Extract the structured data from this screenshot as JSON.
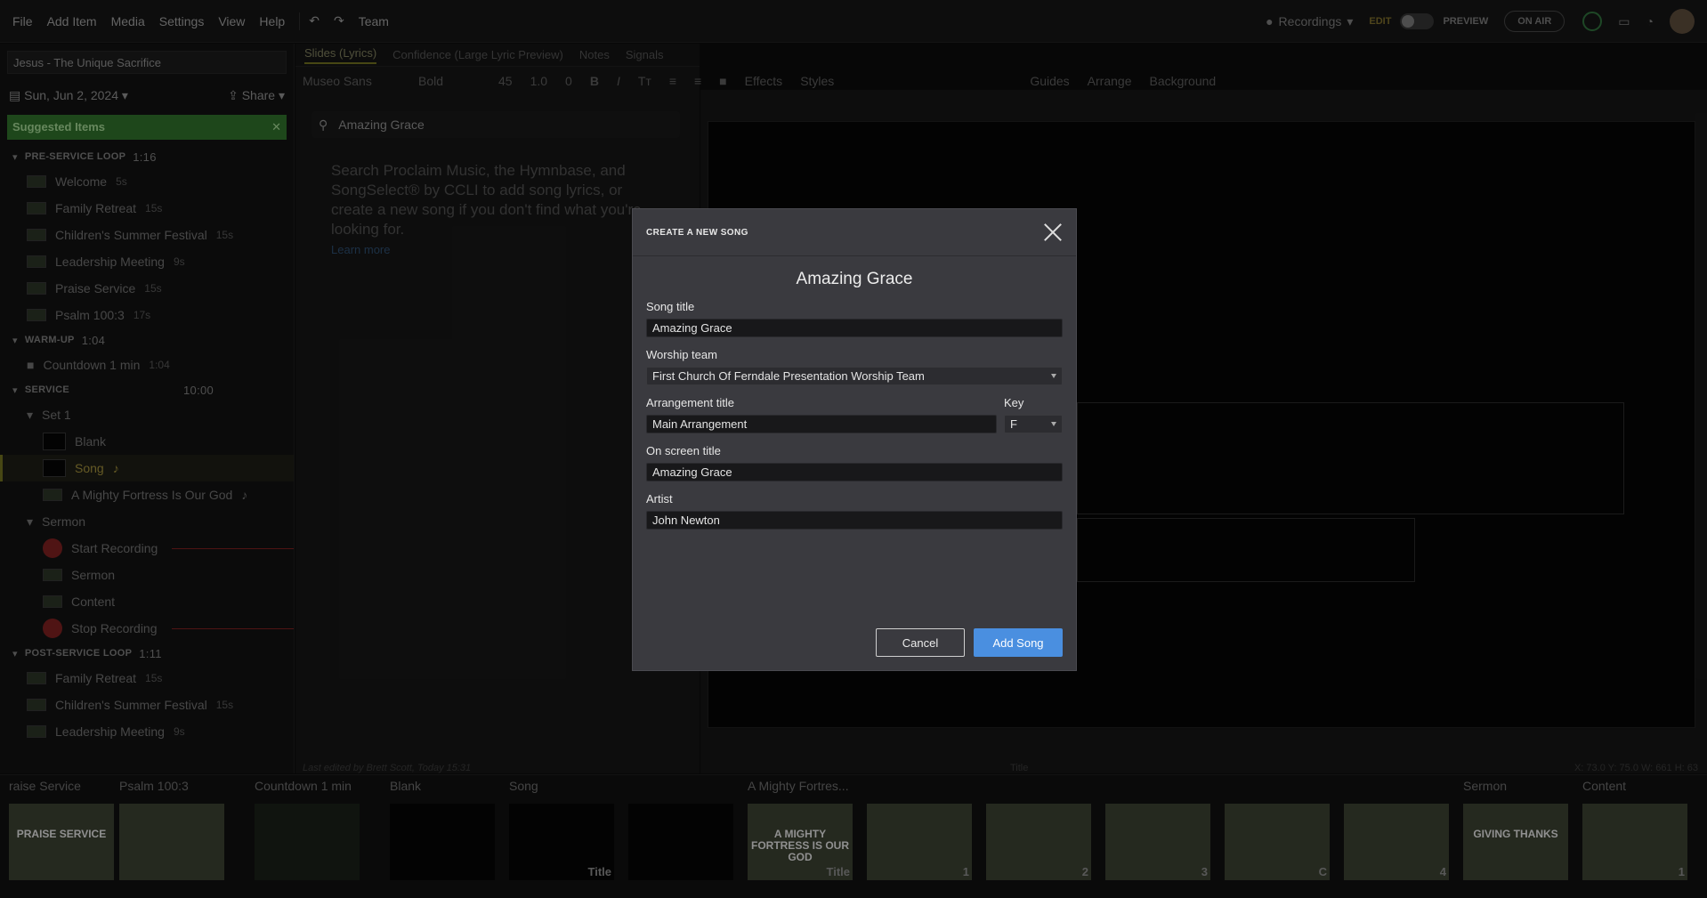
{
  "menu": [
    "File",
    "Add Item",
    "Media",
    "Settings",
    "View",
    "Help"
  ],
  "team_label": "Team",
  "recordings_label": "Recordings",
  "edit_label": "EDIT",
  "preview_label": "PREVIEW",
  "onair_label": "ON AIR",
  "presentation_title": "Jesus - The Unique Sacrifice",
  "date_label": "Sun, Jun 2, 2024",
  "share_label": "Share",
  "suggested_label": "Suggested Items",
  "sections": {
    "preservice": {
      "name": "PRE-SERVICE LOOP",
      "time": "1:16"
    },
    "warmup": {
      "name": "WARM-UP",
      "time": "1:04"
    },
    "service": {
      "name": "SERVICE",
      "time": "10:00"
    },
    "postservice": {
      "name": "POST-SERVICE LOOP",
      "time": "1:11"
    }
  },
  "preservice_items": [
    {
      "label": "Welcome",
      "dur": "5s"
    },
    {
      "label": "Family Retreat",
      "dur": "15s"
    },
    {
      "label": "Children's Summer Festival",
      "dur": "15s"
    },
    {
      "label": "Leadership Meeting",
      "dur": "9s"
    },
    {
      "label": "Praise Service",
      "dur": "15s"
    },
    {
      "label": "Psalm 100:3",
      "dur": "17s"
    }
  ],
  "warmup_items": [
    {
      "label": "Countdown 1 min",
      "dur": "1:04"
    }
  ],
  "service_items": {
    "set1": "Set 1",
    "blank": "Blank",
    "song": "Song",
    "fortress": "A Mighty Fortress Is Our God",
    "sermon_group": "Sermon",
    "start_rec": "Start Recording",
    "sermon": "Sermon",
    "content": "Content",
    "stop_rec": "Stop Recording"
  },
  "postservice_items": [
    {
      "label": "Family Retreat",
      "dur": "15s"
    },
    {
      "label": "Children's Summer Festival",
      "dur": "15s"
    },
    {
      "label": "Leadership Meeting",
      "dur": "9s"
    }
  ],
  "center": {
    "tabs": [
      "Slides (Lyrics)",
      "Confidence (Large Lyric Preview)",
      "Notes",
      "Signals"
    ],
    "search_value": "Amazing Grace",
    "help_text": "Search Proclaim Music, the Hymnbase, and SongSelect® by CCLI to add song lyrics, or create a new song if you don't find what you're looking for.",
    "learn_more": "Learn more"
  },
  "toolbar": {
    "font": "Museo Sans",
    "weight": "Bold",
    "size": "45",
    "line": "1.0",
    "spacing": "0",
    "effects": "Effects",
    "styles": "Styles",
    "guides": "Guides",
    "arrange": "Arrange",
    "background": "Background"
  },
  "status": {
    "last_edited": "Last edited by Brett Scott, Today 15:31",
    "title_label": "Title",
    "coords": "X: 73.0  Y: 75.0    W: 661  H: 63"
  },
  "strip": {
    "slots": [
      {
        "label": "raise Service",
        "text": "PRAISE SERVICE"
      },
      {
        "label": "Psalm 100:3",
        "text": ""
      },
      {
        "label": "Countdown 1 min",
        "text": ""
      },
      {
        "label": "Blank",
        "text": ""
      },
      {
        "label": "Song",
        "text": ""
      },
      {
        "label": "",
        "text": ""
      },
      {
        "label": "A Mighty Fortres...",
        "text": "A MIGHTY FORTRESS IS OUR GOD"
      },
      {
        "label": "",
        "text": ""
      },
      {
        "label": "",
        "text": ""
      },
      {
        "label": "",
        "text": ""
      },
      {
        "label": "",
        "text": ""
      },
      {
        "label": "",
        "text": ""
      },
      {
        "label": "Sermon",
        "text": "GIVING THANKS"
      },
      {
        "label": "Content",
        "text": ""
      }
    ],
    "title_tag": "Title",
    "numbers": [
      "1",
      "2",
      "3",
      "C",
      "4",
      "1"
    ]
  },
  "dialog": {
    "header": "CREATE A NEW SONG",
    "title": "Amazing Grace",
    "song_title_label": "Song title",
    "song_title_value": "Amazing Grace",
    "team_label": "Worship team",
    "team_value": "First Church Of Ferndale Presentation Worship Team",
    "arrangement_label": "Arrangement title",
    "arrangement_value": "Main Arrangement",
    "key_label": "Key",
    "key_value": "F",
    "onscreen_label": "On screen title",
    "onscreen_value": "Amazing Grace",
    "artist_label": "Artist",
    "artist_value": "John Newton",
    "cancel_label": "Cancel",
    "add_label": "Add Song"
  }
}
